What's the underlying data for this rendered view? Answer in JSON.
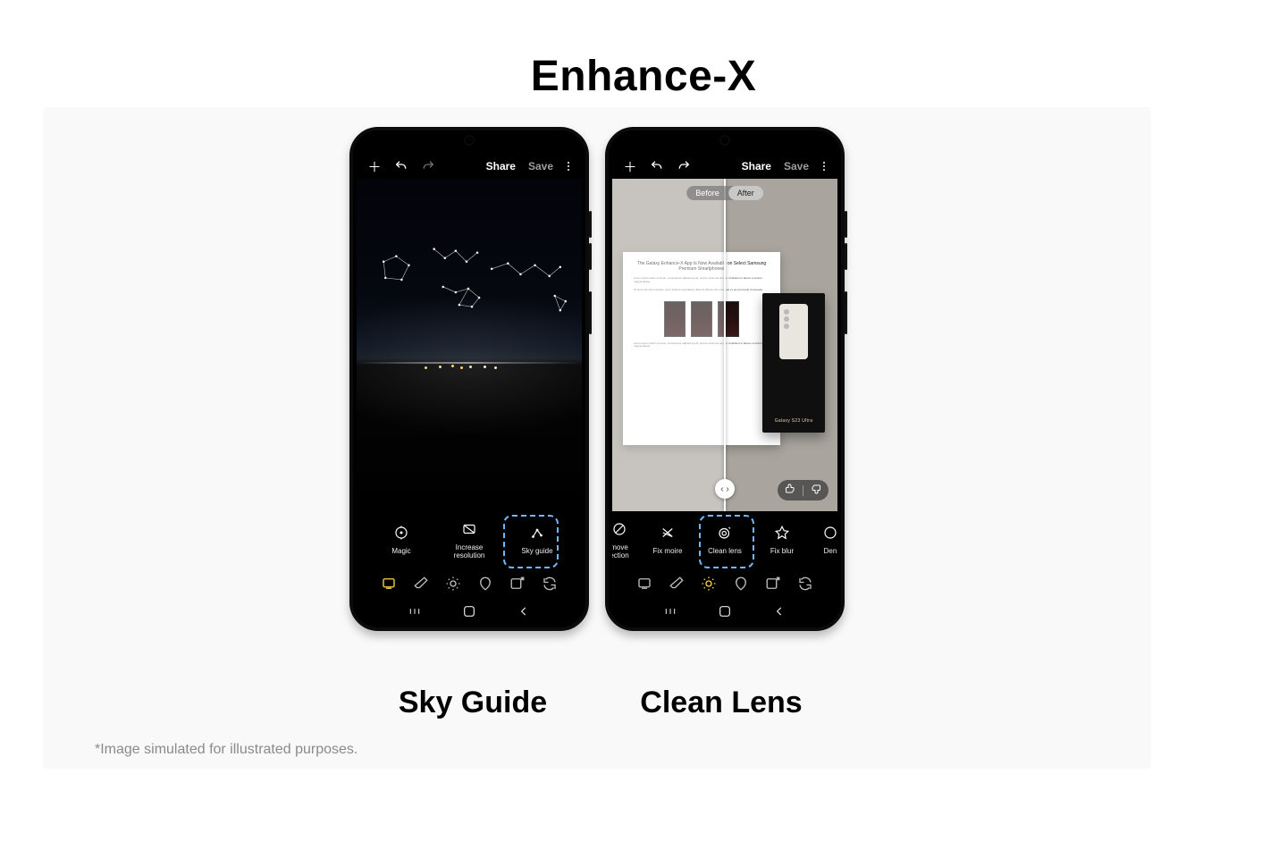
{
  "page": {
    "title": "Enhance-X",
    "disclaimer": "*Image simulated for illustrated purposes."
  },
  "captions": {
    "left": "Sky Guide",
    "right": "Clean Lens"
  },
  "topbar": {
    "share": "Share",
    "save": "Save"
  },
  "phone1": {
    "features": [
      {
        "key": "magic",
        "label": "Magic"
      },
      {
        "key": "increase-resolution",
        "label": "Increase\nresolution"
      },
      {
        "key": "sky-guide",
        "label": "Sky guide",
        "highlighted": true
      }
    ],
    "tabs": {
      "active_index": 0
    }
  },
  "phone2": {
    "compare": {
      "before": "Before",
      "after": "After",
      "split_percent": 50,
      "knob_glyph": "‹ ›"
    },
    "paper": {
      "title": "The Galaxy Enhance-X App Is Now Available on Select Samsung Premium Smartphones",
      "para1": "Lorem ipsum dolor sit amet, consectetur adipiscing elit, sed do eiusmod tempor incididunt ut labore et dolore magna aliqua.",
      "para2": "Ut enim ad minim veniam, quis nostrud exercitation ullamco laboris nisi ut aliquip ex ea commodo consequat."
    },
    "box_label": "Galaxy S23 Ultra",
    "features": [
      {
        "key": "remove-reflection",
        "label": "move\nection",
        "truncated": "left"
      },
      {
        "key": "fix-moire",
        "label": "Fix moire"
      },
      {
        "key": "clean-lens",
        "label": "Clean lens",
        "highlighted": true
      },
      {
        "key": "fix-blur",
        "label": "Fix blur"
      },
      {
        "key": "denoise",
        "label": "Den",
        "truncated": "right"
      }
    ],
    "tabs": {
      "active_index": 2
    }
  }
}
